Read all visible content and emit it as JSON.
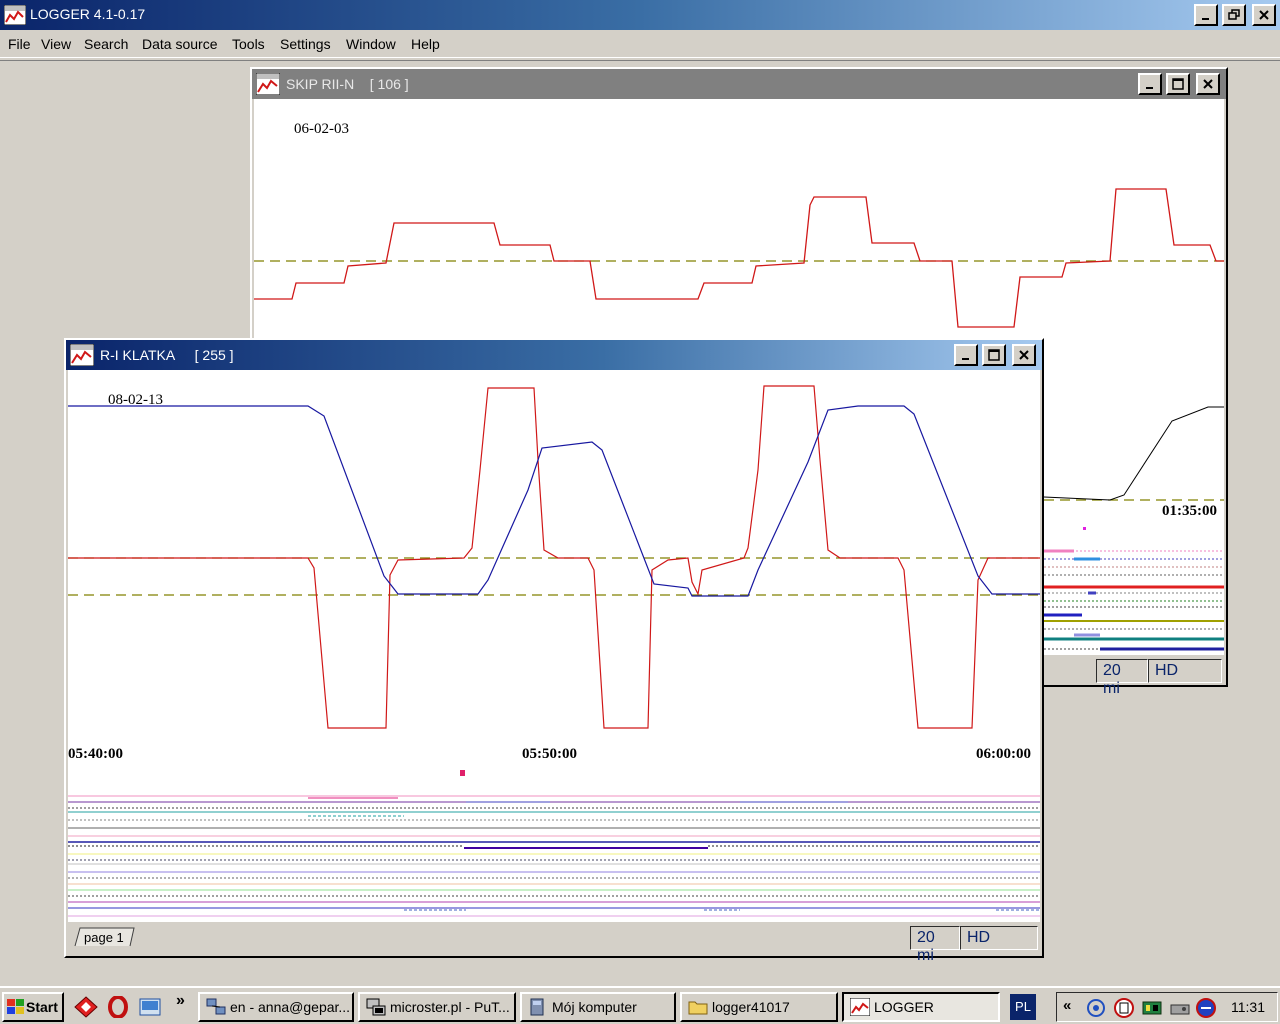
{
  "app": {
    "title": "LOGGER 4.1-0.17",
    "menu": [
      "File",
      "View",
      "Search",
      "Data source",
      "Tools",
      "Settings",
      "Window",
      "Help"
    ]
  },
  "window_skip": {
    "title": "SKIP RII-N",
    "id": "[ 106 ]",
    "date": "06-02-03",
    "time_label": "01:35:00",
    "status_zoom": "20 mi",
    "status_mode": "HD"
  },
  "window_klatka": {
    "title": "R-I KLATKA",
    "id": "[ 255 ]",
    "date": "08-02-13",
    "time_ticks": [
      "05:40:00",
      "05:50:00",
      "06:00:00"
    ],
    "tab": "page 1",
    "status_zoom": "20 mi",
    "status_mode": "HD"
  },
  "taskbar": {
    "start": "Start",
    "more": "»",
    "tasks": [
      {
        "label": "en - anna@gepar...",
        "active": false
      },
      {
        "label": "microster.pl - PuT...",
        "active": false
      },
      {
        "label": "Mój komputer",
        "active": false
      },
      {
        "label": "logger41017",
        "active": false
      },
      {
        "label": "LOGGER",
        "active": true
      }
    ],
    "language": "PL",
    "tray_collapse": "«",
    "clock": "11:31"
  },
  "colors": {
    "series_red": "#d01818",
    "series_blue": "#1818a0",
    "dashed_ref": "#808000",
    "titlebar_active": "#0a246a",
    "titlebar_inactive": "#808080"
  }
}
